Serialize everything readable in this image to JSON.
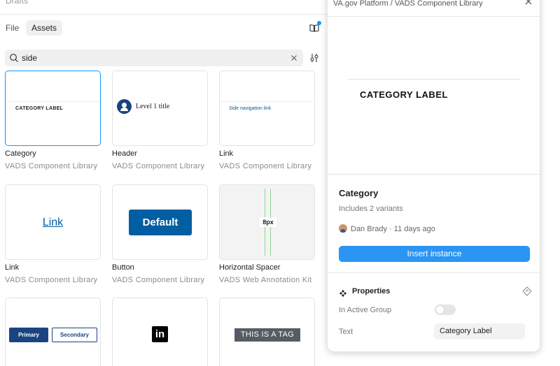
{
  "left_panel": {
    "drafts_label": "Drafts",
    "tabs": [
      {
        "label": "File"
      },
      {
        "label": "Assets"
      }
    ],
    "search": {
      "value": "side",
      "icon": "search-icon"
    },
    "cards": [
      {
        "name": "Category",
        "library": "VADS Component Library",
        "preview_text": "CATEGORY LABEL"
      },
      {
        "name": "Header",
        "library": "VADS Component Library",
        "preview_text": "Level 1 title"
      },
      {
        "name": "Link",
        "library": "VADS Component Library",
        "preview_text": "Side navigation link"
      },
      {
        "name": "Link",
        "library": "VADS Component Library",
        "preview_text": "Link"
      },
      {
        "name": "Button",
        "library": "VADS Component Library",
        "preview_text": "Default"
      },
      {
        "name": "Horizontal Spacer",
        "library": "VADS Web Annotation Kit",
        "preview_text": "8px"
      },
      {
        "name": "",
        "library": "",
        "preview_primary": "Primary",
        "preview_secondary": "Secondary"
      },
      {
        "name": "",
        "library": "",
        "preview_text": "in"
      },
      {
        "name": "",
        "library": "",
        "preview_text": "THIS IS A TAG"
      }
    ]
  },
  "detail": {
    "breadcrumb": "VA.gov Platform / VADS Component Library",
    "preview_text": "CATEGORY LABEL",
    "title": "Category",
    "variants": "Includes 2 variants",
    "author": "Dan Brady",
    "separator": "·",
    "time": "11 days ago",
    "insert_button": "Insert instance",
    "properties": {
      "title": "Properties",
      "rows": [
        {
          "label": "In Active Group",
          "type": "toggle",
          "value": false
        },
        {
          "label": "Text",
          "type": "text",
          "value": "Category Label"
        }
      ]
    }
  },
  "colors": {
    "accent": "#0d99ff",
    "button": "#2a95f2",
    "vads_blue": "#005ea2",
    "vads_dark_blue": "#1a4480"
  }
}
